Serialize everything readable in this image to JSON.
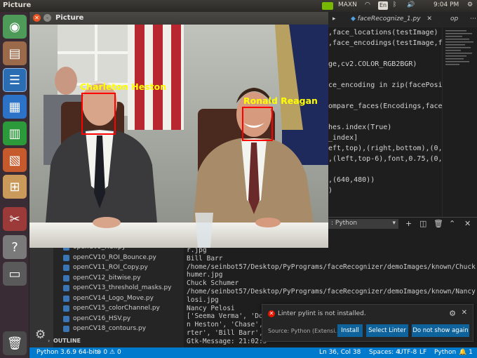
{
  "panel": {
    "app_title": "Picture",
    "maxn": "MAXN",
    "keyboard": "En",
    "time": "9:04 PM"
  },
  "launcher": {
    "items": [
      "ubuntu-home-icon",
      "files-icon",
      "text-editor-icon",
      "writer-icon",
      "calc-icon",
      "impress-icon",
      "software-center-icon",
      "settings-icon",
      "help-icon",
      "drive-icon",
      "trash-icon"
    ]
  },
  "picture_window": {
    "title": "Picture",
    "faces": [
      {
        "name": "Charleton Heston"
      },
      {
        "name": "Ronald Reagan"
      }
    ]
  },
  "editor": {
    "tabs": [
      "faceRecognize_1.py",
      "op"
    ],
    "lines": [
      ",face_locations(testImage)",
      ",face_encodings(testImage,face",
      "",
      "ge,cv2.COLOR_RGB2BGR)",
      "",
      "ce_encoding in zip(facePositio",
      "",
      "ompare_faces(Encodings,face_en",
      "",
      "hes.index(True)",
      "_index]",
      "eft,top),(right,bottom),(0,0,",
      ",(left,top-6),font,0.75,(0,25",
      "",
      ",(640,480))",
      ")"
    ]
  },
  "terminal": {
    "dropdown": ": Python",
    "lines": [
      "r.jpg",
      "Bill Barr",
      "/home/seinbot57/Desktop/PyPrograms/faceRecognizer/demoImages/known/Chuck Sc",
      "humer.jpg",
      "Chuck Schumer",
      "/home/seinbot57/Desktop/PyPrograms/faceRecognizer/demoImages/known/Nancy Pe",
      "losi.jpg",
      "Nancy Pelosi",
      "['Seema Verma', 'Dona",
      "n Heston', 'Chase', '",
      "rter', 'Bill Barr', '",
      "Gtk-Message: 21:02:5"
    ]
  },
  "explorer": {
    "files": [
      "openCV9_ROI.py",
      "openCV10_ROI_Bounce.py",
      "openCV11_ROI_Copy.py",
      "openCV12_bitwise.py",
      "openCV13_threshold_masks.py",
      "openCV14_Logo_Move.py",
      "openCV15_colorChannel.py",
      "openCV16_HSV.py",
      "openCV18_contours.py"
    ],
    "outline": "OUTLINE"
  },
  "notification": {
    "message": "Linter pylint is not installed.",
    "source": "Source: Python (Extensi...",
    "buttons": [
      "Install",
      "Select Linter",
      "Do not show again"
    ]
  },
  "statusbar": {
    "python": "Python 3.6.9 64-bit",
    "errors": "0",
    "warnings": "0",
    "position": "Ln 36, Col 38",
    "spaces": "Spaces: 4",
    "encoding": "UTF-8",
    "eol": "LF",
    "language": "Python",
    "notifications": "1"
  },
  "colors": {
    "accent": "#007acc",
    "launcher": "#3a2c34",
    "face_box": "#ff0000",
    "face_label": "#ffff00"
  }
}
